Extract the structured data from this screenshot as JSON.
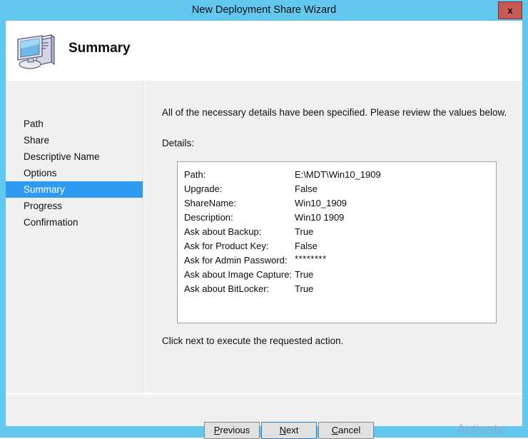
{
  "window": {
    "title": "New Deployment Share Wizard",
    "close_label": "x",
    "titlebar_color": "#62c8ef",
    "close_button_color": "#c75b54"
  },
  "header": {
    "title": "Summary",
    "icon": "computer-icon"
  },
  "sidebar": {
    "selected_index": 4,
    "accent_color": "#2e9bf0",
    "items": [
      {
        "label": "Path"
      },
      {
        "label": "Share"
      },
      {
        "label": "Descriptive Name"
      },
      {
        "label": "Options"
      },
      {
        "label": "Summary"
      },
      {
        "label": "Progress"
      },
      {
        "label": "Confirmation"
      }
    ]
  },
  "content": {
    "intro": "All of the necessary details have been specified.  Please review the values below.",
    "details_label": "Details:",
    "next_hint": "Click next to execute the requested action.",
    "details": [
      {
        "key": "Path:",
        "value": "E:\\MDT\\Win10_1909"
      },
      {
        "key": "Upgrade:",
        "value": "False"
      },
      {
        "key": "ShareName:",
        "value": "Win10_1909"
      },
      {
        "key": "Description:",
        "value": "Win10 1909"
      },
      {
        "key": "Ask about Backup:",
        "value": "True"
      },
      {
        "key": "Ask for Product Key:",
        "value": "False"
      },
      {
        "key": "Ask for Admin Password:",
        "value": "********"
      },
      {
        "key": "Ask about Image Capture:",
        "value": "True"
      },
      {
        "key": "Ask about BitLocker:",
        "value": "True"
      }
    ]
  },
  "buttons": {
    "previous": {
      "prefix": "",
      "accel": "P",
      "suffix": "revious"
    },
    "next": {
      "prefix": "",
      "accel": "N",
      "suffix": "ext"
    },
    "cancel": {
      "prefix": "",
      "accel": "C",
      "suffix": "ancel"
    }
  },
  "watermark": {
    "text": "Activate"
  }
}
